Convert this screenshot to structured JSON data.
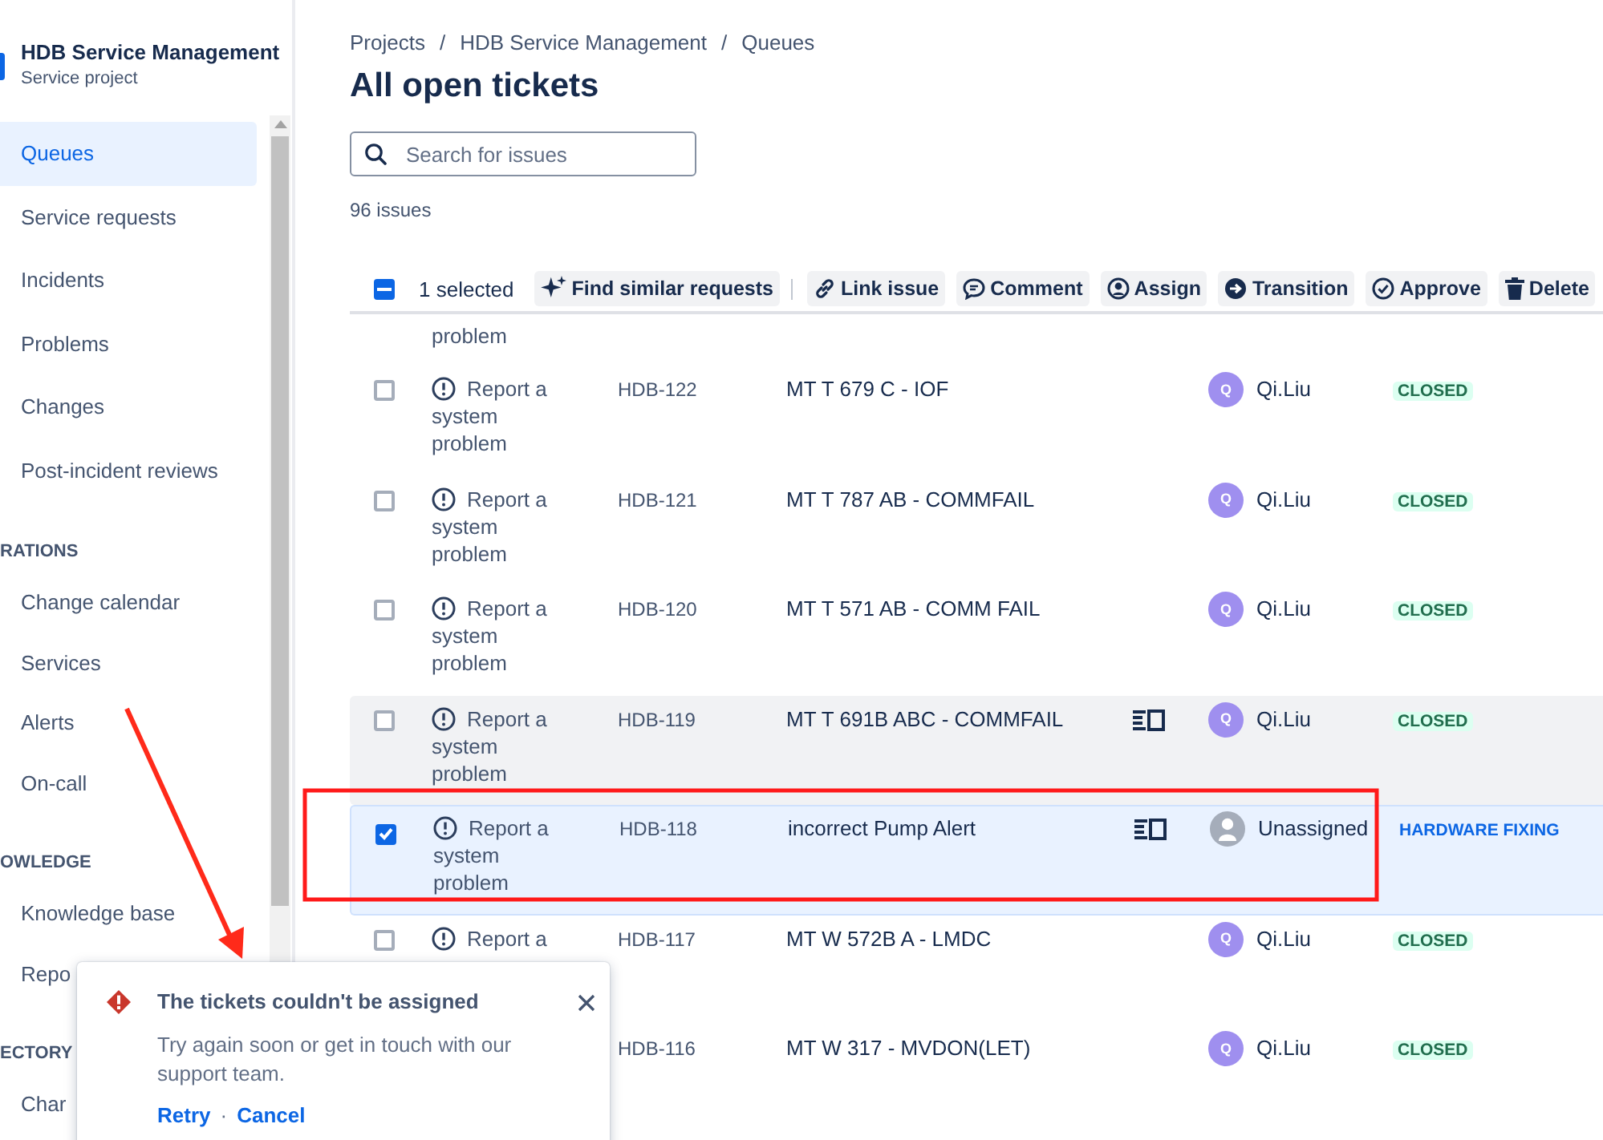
{
  "project": {
    "name": "HDB Service Management",
    "subtitle": "Service project"
  },
  "sidebar": {
    "items": [
      {
        "kind": "item",
        "label": "Queues",
        "selected": true
      },
      {
        "kind": "item",
        "label": "Service requests",
        "selected": false
      },
      {
        "kind": "item",
        "label": "Incidents",
        "selected": false
      },
      {
        "kind": "item",
        "label": "Problems",
        "selected": false
      },
      {
        "kind": "item",
        "label": "Changes",
        "selected": false
      },
      {
        "kind": "item",
        "label": "Post-incident reviews",
        "selected": false
      },
      {
        "kind": "section",
        "label": "RATIONS"
      },
      {
        "kind": "item",
        "label": "Change calendar",
        "selected": false
      },
      {
        "kind": "item",
        "label": "Services",
        "selected": false
      },
      {
        "kind": "item",
        "label": "Alerts",
        "selected": false
      },
      {
        "kind": "item",
        "label": "On-call",
        "selected": false
      },
      {
        "kind": "section",
        "label": "OWLEDGE"
      },
      {
        "kind": "item",
        "label": "Knowledge base",
        "selected": false
      },
      {
        "kind": "item",
        "label": "Repo",
        "selected": false
      },
      {
        "kind": "section",
        "label": "ECTORY"
      },
      {
        "kind": "item",
        "label": "Char",
        "selected": false
      }
    ]
  },
  "breadcrumbs": [
    "Projects",
    "HDB Service Management",
    "Queues"
  ],
  "breadcrumb_separator": "/",
  "title": "All open tickets",
  "search": {
    "placeholder": "Search for issues"
  },
  "issue_count": "96 issues",
  "bulk_bar": {
    "checked": true,
    "mixed": true,
    "selected_text": "1 selected",
    "actions": [
      "Find similar requests",
      "Link issue",
      "Comment",
      "Assign",
      "Transition",
      "Approve",
      "Delete"
    ]
  },
  "rows": [
    {
      "partial": true,
      "type": "problem"
    },
    {
      "type": "Report a system problem",
      "key": "HDB-122",
      "summary": "MT T 679 C - IOF",
      "detail_icon": false,
      "avatar": "Q",
      "assignee": "Qi.Liu",
      "status": "CLOSED",
      "status_done": true,
      "selected": false,
      "hovered": false
    },
    {
      "type": "Report a system problem",
      "key": "HDB-121",
      "summary": "MT T 787 AB - COMMFAIL",
      "detail_icon": false,
      "avatar": "Q",
      "assignee": "Qi.Liu",
      "status": "CLOSED",
      "status_done": true,
      "selected": false,
      "hovered": false
    },
    {
      "type": "Report a system problem",
      "key": "HDB-120",
      "summary": "MT T 571 AB - COMM FAIL",
      "detail_icon": false,
      "avatar": "Q",
      "assignee": "Qi.Liu",
      "status": "CLOSED",
      "status_done": true,
      "selected": false,
      "hovered": false
    },
    {
      "type": "Report a system problem",
      "key": "HDB-119",
      "summary": "MT T 691B ABC - COMMFAIL",
      "detail_icon": true,
      "avatar": "Q",
      "assignee": "Qi.Liu",
      "status": "CLOSED",
      "status_done": true,
      "selected": false,
      "hovered": true
    },
    {
      "type": "Report a system problem",
      "key": "HDB-118",
      "summary": "incorrect Pump Alert",
      "detail_icon": true,
      "assignee": "Unassigned",
      "status": "HARDWARE FIXING",
      "status_done": false,
      "selected": true,
      "hovered": false
    },
    {
      "type": "Report a",
      "key": "HDB-117",
      "summary": "MT W 572B A - LMDC",
      "detail_icon": false,
      "avatar": "Q",
      "assignee": "Qi.Liu",
      "status": "CLOSED",
      "status_done": true,
      "selected": false,
      "hovered": false
    },
    {
      "key": "HDB-116",
      "summary": "MT W 317 - MVDON(LET)",
      "detail_icon": false,
      "avatar": "Q",
      "assignee": "Qi.Liu",
      "status": "CLOSED",
      "status_done": true,
      "hovered": false
    }
  ],
  "toast": {
    "title": "The tickets couldn't be assigned",
    "message": "Try again soon or get in touch with our support team.",
    "actions": [
      "Retry",
      "Cancel"
    ],
    "separator": "·"
  }
}
